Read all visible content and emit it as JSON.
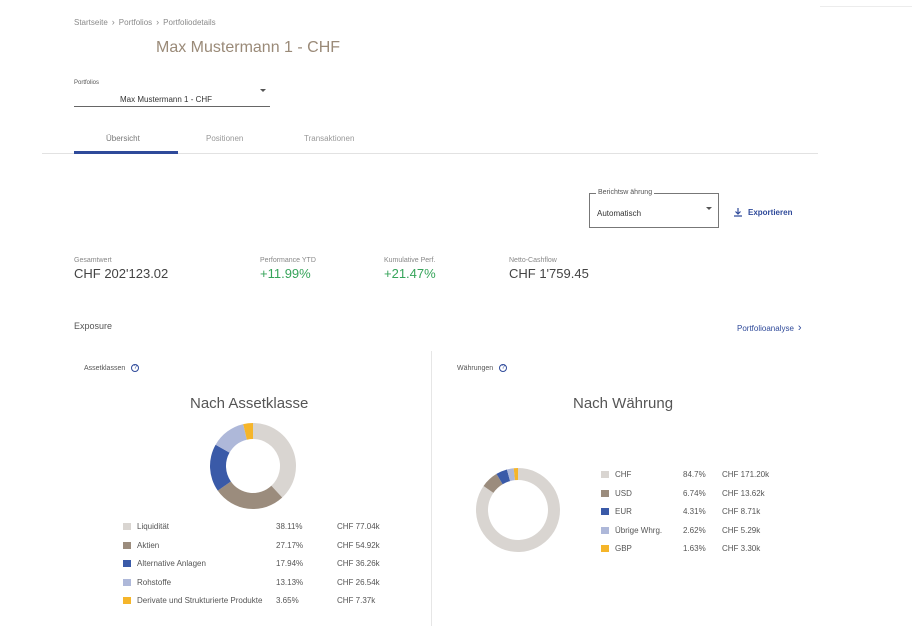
{
  "breadcrumb": {
    "items": [
      "Startseite",
      "Portfolios",
      "Portfoliodetails"
    ]
  },
  "page": {
    "title": "Max Mustermann 1 - CHF"
  },
  "portfolio_select": {
    "label": "Portfolios",
    "value": "Max Mustermann 1 - CHF"
  },
  "tabs": [
    {
      "label": "Übersicht",
      "active": true
    },
    {
      "label": "Positionen",
      "active": false
    },
    {
      "label": "Transaktionen",
      "active": false
    }
  ],
  "currency_select": {
    "label": "Berichtsw ährung",
    "value": "Automatisch"
  },
  "export": {
    "label": "Exportieren"
  },
  "kpis": [
    {
      "label": "Gesamtwert",
      "value": "CHF 202'123.02"
    },
    {
      "label": "Performance YTD",
      "value": "+11.99%"
    },
    {
      "label": "Kumulative Perf.",
      "value": "+21.47%"
    },
    {
      "label": "Netto-Cashflow",
      "value": "CHF 1'759.45"
    }
  ],
  "exposure": {
    "title": "Exposure",
    "link_label": "Portfolioanalyse"
  },
  "colors": {
    "accent": "#2f4a9a",
    "positive": "#36a45a",
    "liquiditaet": "#d9d5d1",
    "aktien": "#9b8c7d",
    "alternative": "#3a5aa8",
    "rohstoffe": "#aeb8d9",
    "derivate": "#f5b52a"
  },
  "asset_classes": {
    "section_label": "Assetklassen",
    "chart_title": "Nach Assetklasse",
    "items": [
      {
        "name": "Liquidität",
        "pct": "38.11%",
        "amount": "CHF 77.04k",
        "value": 38.11,
        "color": "#d9d5d1"
      },
      {
        "name": "Aktien",
        "pct": "27.17%",
        "amount": "CHF 54.92k",
        "value": 27.17,
        "color": "#9b8c7d"
      },
      {
        "name": "Alternative Anlagen",
        "pct": "17.94%",
        "amount": "CHF 36.26k",
        "value": 17.94,
        "color": "#3a5aa8"
      },
      {
        "name": "Rohstoffe",
        "pct": "13.13%",
        "amount": "CHF 26.54k",
        "value": 13.13,
        "color": "#aeb8d9"
      },
      {
        "name": "Derivate und Strukturierte Produkte",
        "pct": "3.65%",
        "amount": "CHF 7.37k",
        "value": 3.65,
        "color": "#f5b52a"
      }
    ]
  },
  "currencies": {
    "section_label": "Währungen",
    "chart_title": "Nach Währung",
    "items": [
      {
        "name": "CHF",
        "pct": "84.7%",
        "amount": "CHF 171.20k",
        "value": 84.7,
        "color": "#d9d5d1"
      },
      {
        "name": "USD",
        "pct": "6.74%",
        "amount": "CHF 13.62k",
        "value": 6.74,
        "color": "#9b8c7d"
      },
      {
        "name": "EUR",
        "pct": "4.31%",
        "amount": "CHF 8.71k",
        "value": 4.31,
        "color": "#3a5aa8"
      },
      {
        "name": "Übrige Whrg.",
        "pct": "2.62%",
        "amount": "CHF 5.29k",
        "value": 2.62,
        "color": "#aeb8d9"
      },
      {
        "name": "GBP",
        "pct": "1.63%",
        "amount": "CHF 3.30k",
        "value": 1.63,
        "color": "#f5b52a"
      }
    ]
  }
}
